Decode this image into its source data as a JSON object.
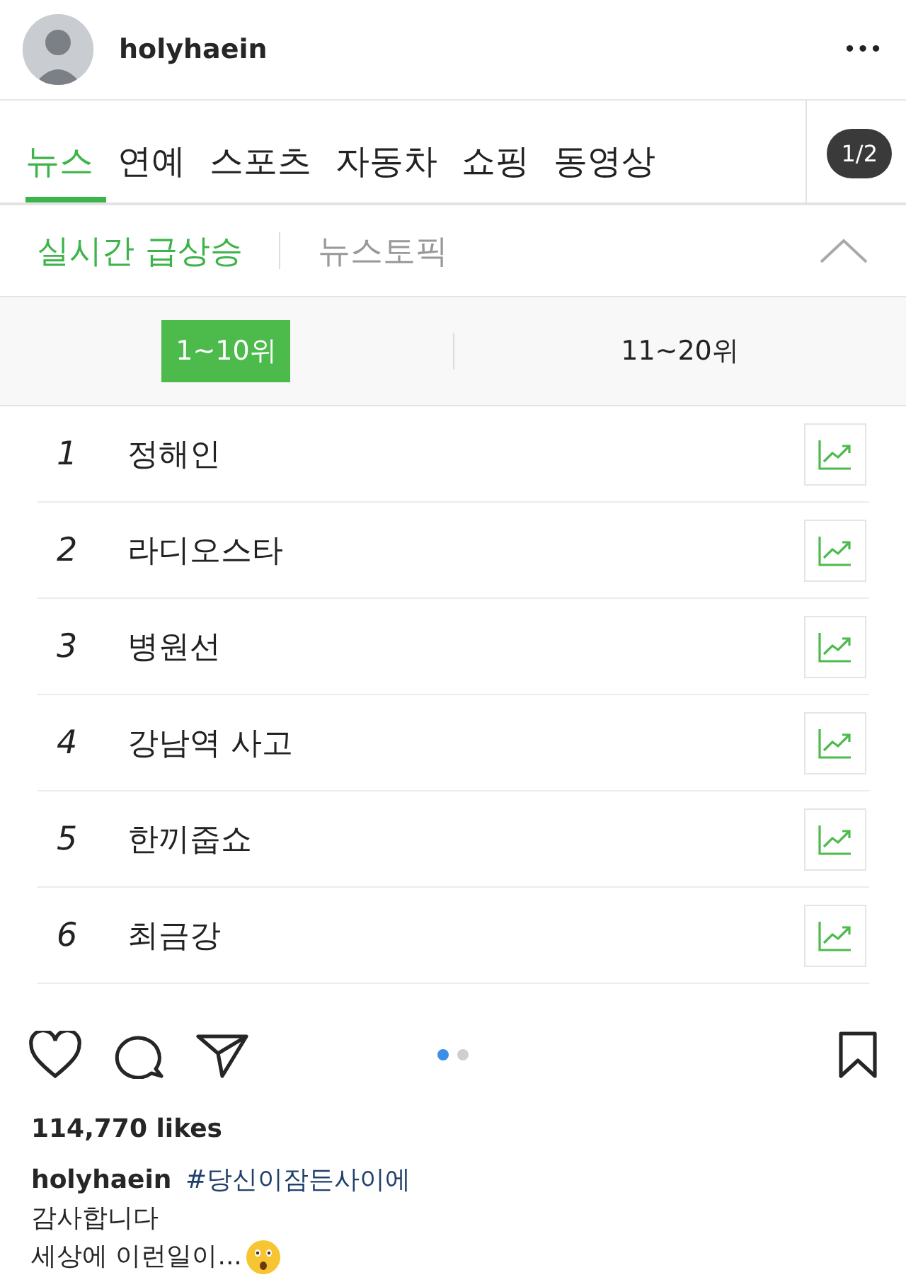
{
  "header": {
    "username": "holyhaein",
    "more": "•••"
  },
  "post": {
    "tabs": [
      {
        "label": "뉴스",
        "selected": true
      },
      {
        "label": "연예",
        "selected": false
      },
      {
        "label": "스포츠",
        "selected": false
      },
      {
        "label": "자동차",
        "selected": false
      },
      {
        "label": "쇼핑",
        "selected": false
      },
      {
        "label": "동영상",
        "selected": false
      }
    ],
    "page_badge": "1/2",
    "subtabs": [
      {
        "label": "실시간 급상승",
        "selected": true
      },
      {
        "label": "뉴스토픽",
        "selected": false
      }
    ],
    "ranges": [
      {
        "label": "1~10위",
        "selected": true
      },
      {
        "label": "11~20위",
        "selected": false
      }
    ],
    "ranking": [
      {
        "rank": "1",
        "keyword": "정해인"
      },
      {
        "rank": "2",
        "keyword": "라디오스타"
      },
      {
        "rank": "3",
        "keyword": "병원선"
      },
      {
        "rank": "4",
        "keyword": "강남역 사고"
      },
      {
        "rank": "5",
        "keyword": "한끼줍쇼"
      },
      {
        "rank": "6",
        "keyword": "최금강"
      }
    ]
  },
  "pager": [
    {
      "selected": true
    },
    {
      "selected": false
    }
  ],
  "likes": "114,770 likes",
  "caption": {
    "username": "holyhaein",
    "hashtag": "#당신이잠든사이에",
    "lines": [
      "감사합니다",
      "세상에 이런일이..."
    ]
  }
}
